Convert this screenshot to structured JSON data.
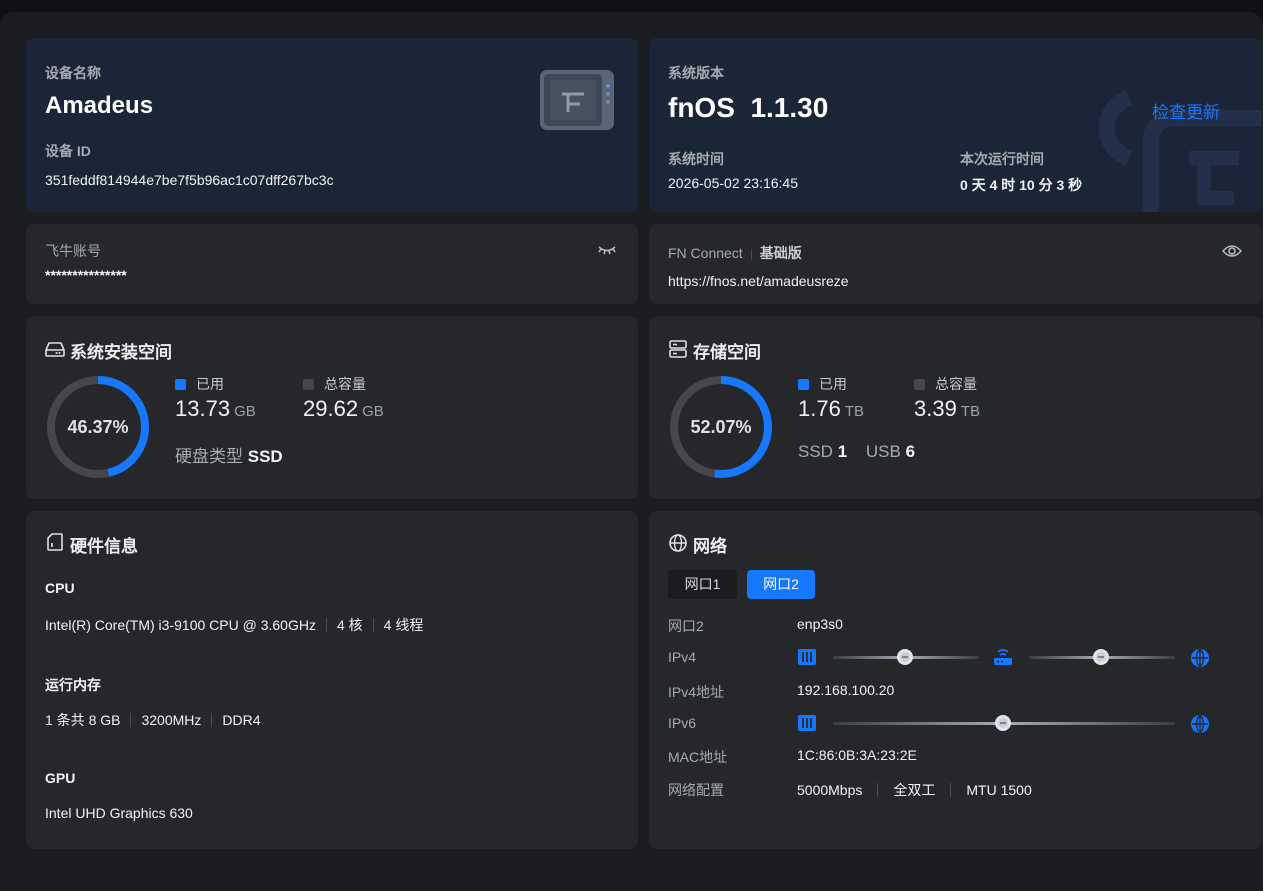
{
  "device": {
    "name_label": "设备名称",
    "name": "Amadeus",
    "id_label": "设备 ID",
    "id": "351feddf814944e7be7f5b96ac1c07dff267bc3c"
  },
  "system": {
    "version_label": "系统版本",
    "version": "fnOS  1.1.30",
    "check_update": "检查更新",
    "time_label": "系统时间",
    "time": "2026-05-02 23:16:45",
    "uptime_label": "本次运行时间",
    "uptime": "0 天 4 时 10 分 3 秒"
  },
  "account": {
    "label": "飞牛账号",
    "value": "***************"
  },
  "connect": {
    "label": "FN Connect",
    "edition": "基础版",
    "url": "https://fnos.net/amadeusreze"
  },
  "sys_space": {
    "title": "系统安装空间",
    "percent_text": "46.37%",
    "percent": 46.37,
    "used_label": "已用",
    "used_value": "13.73",
    "used_unit": "GB",
    "total_label": "总容量",
    "total_value": "29.62",
    "total_unit": "GB",
    "disk_type_label": "硬盘类型",
    "disk_type": "SSD"
  },
  "storage": {
    "title": "存储空间",
    "percent_text": "52.07%",
    "percent": 52.07,
    "used_label": "已用",
    "used_value": "1.76",
    "used_unit": "TB",
    "total_label": "总容量",
    "total_value": "3.39",
    "total_unit": "TB",
    "ssd_label": "SSD",
    "ssd_count": "1",
    "usb_label": "USB",
    "usb_count": "6"
  },
  "hardware": {
    "title": "硬件信息",
    "cpu_label": "CPU",
    "cpu_model": "Intel(R) Core(TM) i3-9100 CPU @ 3.60GHz",
    "cpu_cores": "4 核",
    "cpu_threads": "4 线程",
    "mem_label": "运行内存",
    "mem_count": "1 条共 8 GB",
    "mem_speed": "3200MHz",
    "mem_type": "DDR4",
    "gpu_label": "GPU",
    "gpu_model": "Intel UHD Graphics 630"
  },
  "network": {
    "title": "网络",
    "tabs": [
      "网口1",
      "网口2"
    ],
    "active_tab": "网口2",
    "iface_label": "网口2",
    "iface": "enp3s0",
    "ipv4_label": "IPv4",
    "ipv4_addr_label": "IPv4地址",
    "ipv4_addr": "192.168.100.20",
    "ipv6_label": "IPv6",
    "mac_label": "MAC地址",
    "mac": "1C:86:0B:3A:23:2E",
    "config_label": "网络配置",
    "speed": "5000Mbps",
    "duplex": "全双工",
    "mtu": "MTU 1500"
  },
  "colors": {
    "accent": "#1677ff",
    "ring_track": "#45474c",
    "card": "#26272b",
    "card_blue": "#1b2538"
  }
}
